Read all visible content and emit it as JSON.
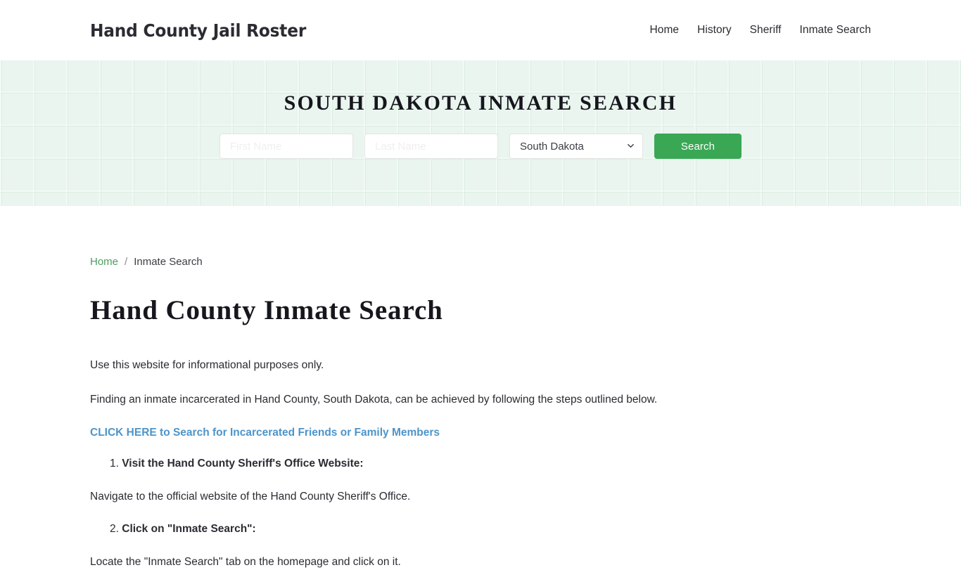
{
  "header": {
    "brand": "Hand County Jail Roster",
    "nav": [
      {
        "label": "Home"
      },
      {
        "label": "History"
      },
      {
        "label": "Sheriff"
      },
      {
        "label": "Inmate Search"
      }
    ]
  },
  "hero": {
    "title": "SOUTH DAKOTA INMATE SEARCH",
    "form": {
      "first_name_placeholder": "First Name",
      "first_name_value": "",
      "last_name_placeholder": "Last Name",
      "last_name_value": "",
      "state_selected": "South Dakota",
      "state_options": [
        "South Dakota"
      ],
      "chevron_icon": "chevron-down-icon",
      "search_label": "Search"
    },
    "accent_color": "#3aa755",
    "background_color": "#e9f5ee"
  },
  "breadcrumb": {
    "home": "Home",
    "separator": "/",
    "current": "Inmate Search"
  },
  "main": {
    "title": "Hand County Inmate Search",
    "intro": "Use this website for informational purposes only.",
    "description": "Finding an inmate incarcerated in Hand County, South Dakota, can be achieved by following the steps outlined below.",
    "cta": "CLICK HERE to Search for Incarcerated Friends or Family Members",
    "cta_color": "#4d94c9",
    "steps": [
      {
        "number": "1.",
        "heading": "Visit the Hand County Sheriff's Office Website:",
        "body": "Navigate to the official website of the Hand County Sheriff's Office."
      },
      {
        "number": "2.",
        "heading": "Click on \"Inmate Search\":",
        "body": "Locate the \"Inmate Search\" tab on the homepage and click on it."
      }
    ]
  }
}
